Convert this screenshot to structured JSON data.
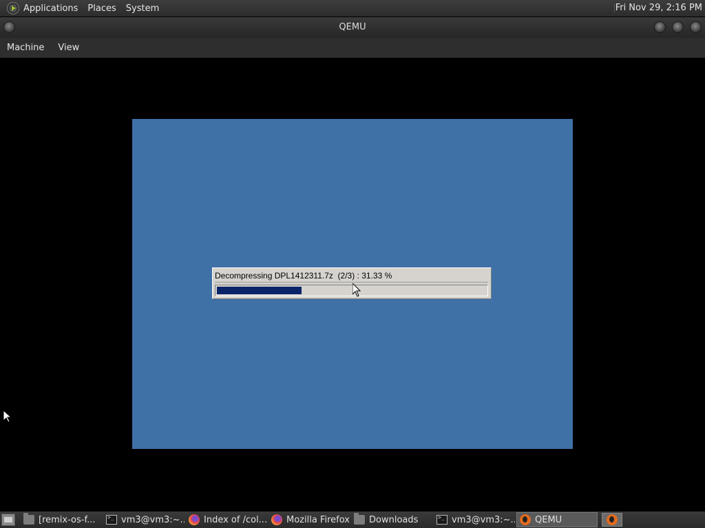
{
  "top_panel": {
    "menus": [
      "Applications",
      "Places",
      "System"
    ],
    "clock": "Fri Nov 29,  2:16 PM"
  },
  "window": {
    "title": "QEMU",
    "menu": [
      "Machine",
      "View"
    ]
  },
  "vm": {
    "progress_text": "Decompressing DPL1412311.7z  (2/3) : 31.33 %",
    "progress_fraction": 0.3133
  },
  "taskbar": {
    "tasks": [
      {
        "label": "[remix-os-f...",
        "icon": "folder-icon"
      },
      {
        "label": "vm3@vm3:~...",
        "icon": "terminal-icon"
      },
      {
        "label": "Index of /col...",
        "icon": "firefox-icon"
      },
      {
        "label": "Mozilla Firefox",
        "icon": "firefox-icon"
      },
      {
        "label": "Downloads",
        "icon": "folder-icon"
      },
      {
        "label": "vm3@vm3:~...",
        "icon": "terminal-icon"
      },
      {
        "label": "QEMU",
        "icon": "qemu-icon",
        "active": true
      }
    ]
  },
  "colors": {
    "vm_background": "#3f70a6",
    "progress_fill": "#0a246a",
    "dialog_face": "#d6d3ce"
  }
}
